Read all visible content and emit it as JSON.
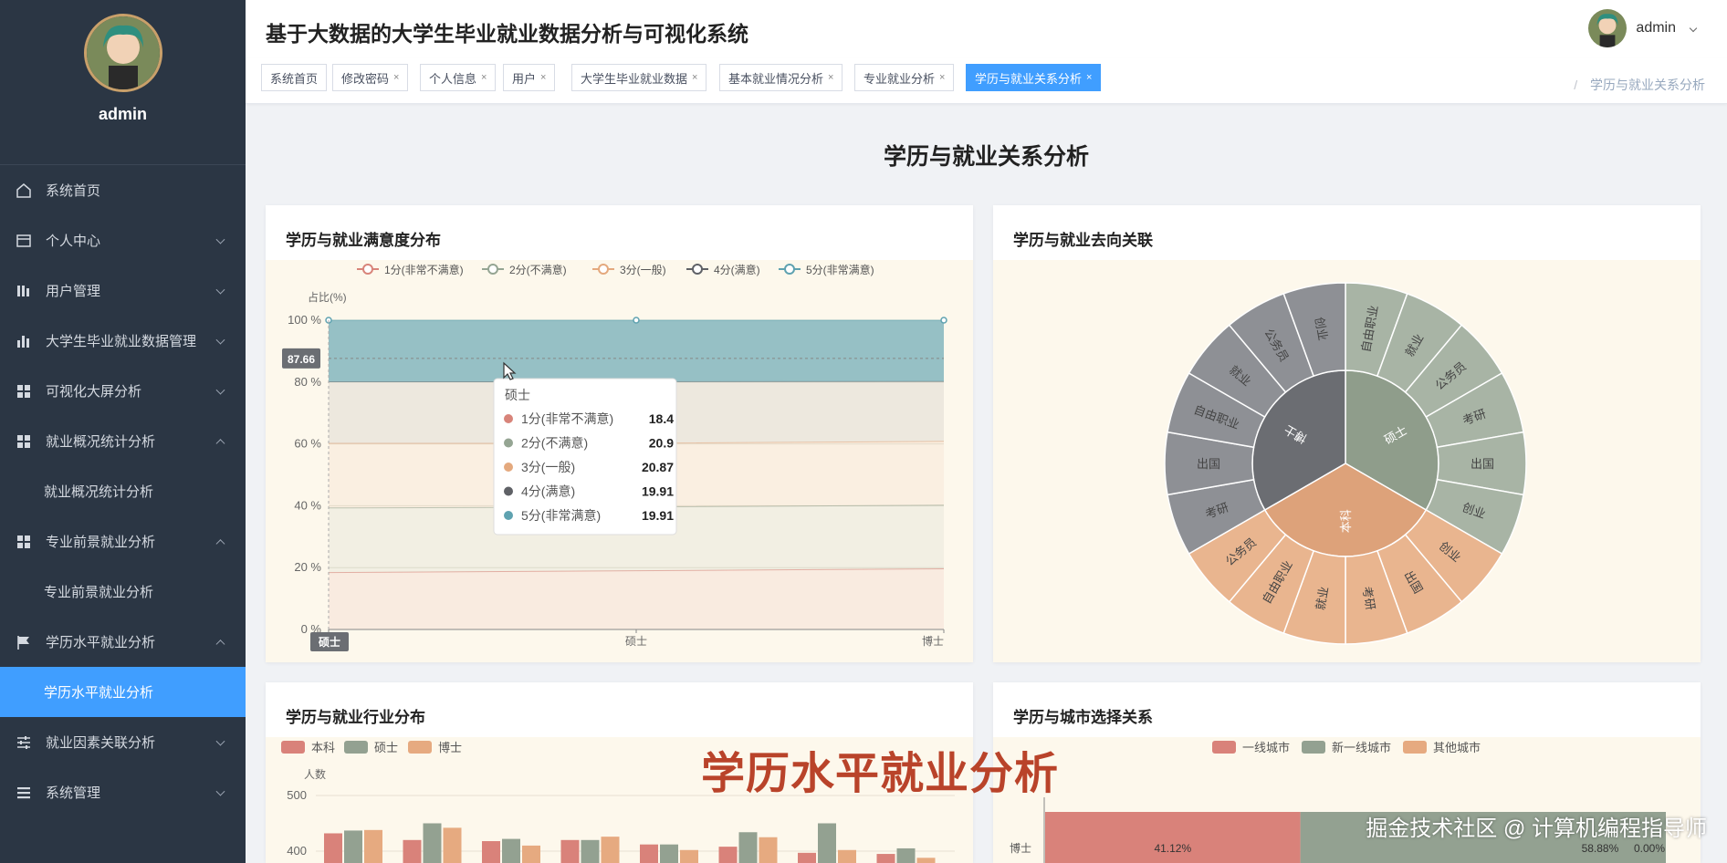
{
  "app": {
    "title": "基于大数据的大学生毕业就业数据分析与可视化系统",
    "user": "admin"
  },
  "sidebar": {
    "profile_name": "admin",
    "items": [
      {
        "label": "系统首页",
        "icon": "home-icon"
      },
      {
        "label": "个人中心",
        "icon": "card-icon",
        "arrow": "down"
      },
      {
        "label": "用户管理",
        "icon": "bars-icon",
        "arrow": "down"
      },
      {
        "label": "大学生毕业就业数据管理",
        "icon": "chart-bars-icon",
        "arrow": "down"
      },
      {
        "label": "可视化大屏分析",
        "icon": "grid-icon",
        "arrow": "down"
      },
      {
        "label": "就业概况统计分析",
        "icon": "grid-icon",
        "arrow": "up"
      },
      {
        "label": "就业概况统计分析",
        "sub": true
      },
      {
        "label": "专业前景就业分析",
        "icon": "grid-icon",
        "arrow": "up"
      },
      {
        "label": "专业前景就业分析",
        "sub": true
      },
      {
        "label": "学历水平就业分析",
        "icon": "flag-icon",
        "arrow": "up"
      },
      {
        "label": "学历水平就业分析",
        "sub": true,
        "active": true
      },
      {
        "label": "就业因素关联分析",
        "icon": "sliders-icon",
        "arrow": "down"
      },
      {
        "label": "系统管理",
        "icon": "list-icon",
        "arrow": "down"
      }
    ]
  },
  "tabs": [
    {
      "label": "系统首页",
      "closable": false
    },
    {
      "label": "修改密码",
      "closable": true
    },
    {
      "label": "个人信息",
      "closable": true
    },
    {
      "label": "用户",
      "closable": true
    },
    {
      "label": "大学生毕业就业数据",
      "closable": true
    },
    {
      "label": "基本就业情况分析",
      "closable": true
    },
    {
      "label": "专业就业分析",
      "closable": true
    },
    {
      "label": "学历与就业关系分析",
      "closable": true,
      "active": true
    }
  ],
  "tab_close_glyph": "×",
  "breadcrumb": {
    "separator": "/",
    "current": "学历与就业关系分析"
  },
  "page": {
    "title": "学历与就业关系分析"
  },
  "colors": {
    "accent": "#409eff",
    "sidebar": "#2b3644"
  },
  "cards": {
    "satisfaction": {
      "title": "学历与就业满意度分布"
    },
    "destination": {
      "title": "学历与就业去向关联"
    },
    "industry": {
      "title": "学历与就业行业分布"
    },
    "city": {
      "title": "学历与城市选择关系"
    }
  },
  "chart_data": [
    {
      "type": "area",
      "title": "学历与就业满意度分布",
      "ylabel": "占比(%)",
      "ylim": [
        0,
        100
      ],
      "yticks": [
        "0 %",
        "20 %",
        "40 %",
        "60 %",
        "80 %",
        "100 %"
      ],
      "categories": [
        "硕士",
        "硕士",
        "博士"
      ],
      "stacked": true,
      "series": [
        {
          "name": "1分(非常不满意)",
          "color": "#d8847a",
          "values": [
            18.4,
            19.0,
            19.6
          ]
        },
        {
          "name": "2分(不满意)",
          "color": "#95a593",
          "values": [
            20.9,
            20.6,
            20.6
          ]
        },
        {
          "name": "3分(一般)",
          "color": "#e4a97e",
          "values": [
            20.87,
            20.6,
            20.6
          ]
        },
        {
          "name": "4分(满意)",
          "color": "#5f6166",
          "values": [
            19.91,
            19.9,
            19.4
          ]
        },
        {
          "name": "5分(非常满意)",
          "color": "#5fa2b0",
          "values": [
            19.91,
            19.9,
            19.8
          ]
        }
      ],
      "axis_pointer": {
        "value": "87.66",
        "category": "硕士"
      },
      "tooltip": {
        "title": "硕士",
        "rows": [
          {
            "name": "1分(非常不满意)",
            "value": "18.4",
            "color": "#d8847a"
          },
          {
            "name": "2分(不满意)",
            "value": "20.9",
            "color": "#95a593"
          },
          {
            "name": "3分(一般)",
            "value": "20.87",
            "color": "#e4a97e"
          },
          {
            "name": "4分(满意)",
            "value": "19.91",
            "color": "#5f6166"
          },
          {
            "name": "5分(非常满意)",
            "value": "19.91",
            "color": "#5fa2b0"
          }
        ]
      },
      "legend": "top"
    },
    {
      "type": "sunburst",
      "title": "学历与就业去向关联",
      "groups": [
        {
          "name": "硕士",
          "color": "#8f9d8b",
          "outer_color": "#a8b4a5",
          "children": [
            "自由职业",
            "就业",
            "公务员",
            "考研",
            "出国",
            "创业"
          ]
        },
        {
          "name": "本科",
          "color": "#dda27a",
          "outer_color": "#e9b58f",
          "children": [
            "创业",
            "出国",
            "考研",
            "就业",
            "自由职业",
            "公务员"
          ]
        },
        {
          "name": "博士",
          "color": "#6b6d72",
          "outer_color": "#8e9095",
          "children": [
            "考研",
            "出国",
            "自由职业",
            "就业",
            "公务员",
            "创业"
          ]
        }
      ]
    },
    {
      "type": "bar",
      "title": "学历与就业行业分布",
      "ylabel": "人数",
      "yticks": [
        "400",
        "500"
      ],
      "series": [
        {
          "name": "本科",
          "color": "#d9827a",
          "values": [
            432,
            420,
            418,
            420,
            412,
            408,
            397,
            395
          ]
        },
        {
          "name": "硕士",
          "color": "#93a191",
          "values": [
            437,
            450,
            422,
            420,
            412,
            434,
            450,
            405
          ]
        },
        {
          "name": "博士",
          "color": "#e6aa80",
          "values": [
            438,
            442,
            410,
            426,
            402,
            425,
            402,
            388
          ]
        }
      ],
      "legend": "top"
    },
    {
      "type": "bar",
      "title": "学历与城市选择关系",
      "stacked": true,
      "orientation": "horizontal",
      "categories": [
        "博士"
      ],
      "series": [
        {
          "name": "一线城市",
          "color": "#d9827a",
          "values": [
            41.12
          ]
        },
        {
          "name": "新一线城市",
          "color": "#93a191",
          "values": [
            58.88
          ]
        },
        {
          "name": "其他城市",
          "color": "#e6aa80",
          "values": [
            0.0
          ]
        }
      ],
      "labels": [
        "41.12%",
        "58.88%",
        "0.00%"
      ],
      "legend": "top"
    }
  ],
  "overlay": {
    "big": "学历水平就业分析",
    "small": "掘金技术社区 @ 计算机编程指导师"
  }
}
